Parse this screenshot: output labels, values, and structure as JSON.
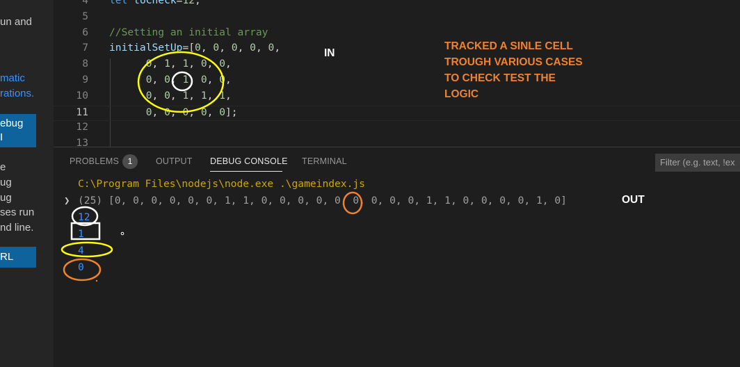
{
  "sidebar": {
    "lines": [
      "un and",
      "matic",
      "rations.",
      "e",
      "ug",
      "ug",
      "ses run",
      "nd line."
    ],
    "buttons": [
      "ebug",
      "I",
      "RL"
    ]
  },
  "editor": {
    "lines": [
      {
        "num": "4",
        "code": [
          {
            "t": "let ",
            "k": "kw"
          },
          {
            "t": "toCheck",
            "k": "var"
          },
          {
            "t": "=",
            "k": ""
          },
          {
            "t": "12",
            "k": "num"
          },
          {
            "t": ";",
            "k": ""
          }
        ]
      },
      {
        "num": "5",
        "code": []
      },
      {
        "num": "6",
        "code": [
          {
            "t": "//Setting an initial array",
            "k": "comment"
          }
        ]
      },
      {
        "num": "7",
        "code": [
          {
            "t": "initialSetUp",
            "k": "var"
          },
          {
            "t": "=[",
            "k": ""
          },
          {
            "t": "0",
            "k": "num"
          },
          {
            "t": ", ",
            "k": ""
          },
          {
            "t": "0",
            "k": "num"
          },
          {
            "t": ", ",
            "k": ""
          },
          {
            "t": "0",
            "k": "num"
          },
          {
            "t": ", ",
            "k": ""
          },
          {
            "t": "0",
            "k": "num"
          },
          {
            "t": ", ",
            "k": ""
          },
          {
            "t": "0",
            "k": "num"
          },
          {
            "t": ",",
            "k": ""
          }
        ]
      },
      {
        "num": "8",
        "code": [
          {
            "t": "      ",
            "k": ""
          },
          {
            "t": "0",
            "k": "num"
          },
          {
            "t": ", ",
            "k": ""
          },
          {
            "t": "1",
            "k": "num"
          },
          {
            "t": ", ",
            "k": ""
          },
          {
            "t": "1",
            "k": "num"
          },
          {
            "t": ", ",
            "k": ""
          },
          {
            "t": "0",
            "k": "num"
          },
          {
            "t": ", ",
            "k": ""
          },
          {
            "t": "0",
            "k": "num"
          },
          {
            "t": ",",
            "k": ""
          }
        ]
      },
      {
        "num": "9",
        "code": [
          {
            "t": "      ",
            "k": ""
          },
          {
            "t": "0",
            "k": "num"
          },
          {
            "t": ", ",
            "k": ""
          },
          {
            "t": "0",
            "k": "num"
          },
          {
            "t": ", ",
            "k": ""
          },
          {
            "t": "1",
            "k": "num"
          },
          {
            "t": ", ",
            "k": ""
          },
          {
            "t": "0",
            "k": "num"
          },
          {
            "t": ", ",
            "k": ""
          },
          {
            "t": "0",
            "k": "num"
          },
          {
            "t": ",",
            "k": ""
          }
        ]
      },
      {
        "num": "10",
        "code": [
          {
            "t": "      ",
            "k": ""
          },
          {
            "t": "0",
            "k": "num"
          },
          {
            "t": ", ",
            "k": ""
          },
          {
            "t": "0",
            "k": "num"
          },
          {
            "t": ", ",
            "k": ""
          },
          {
            "t": "1",
            "k": "num"
          },
          {
            "t": ", ",
            "k": ""
          },
          {
            "t": "1",
            "k": "num"
          },
          {
            "t": ", ",
            "k": ""
          },
          {
            "t": "1",
            "k": "num"
          },
          {
            "t": ",",
            "k": ""
          }
        ]
      },
      {
        "num": "11",
        "active": true,
        "code": [
          {
            "t": "      ",
            "k": ""
          },
          {
            "t": "0",
            "k": "num"
          },
          {
            "t": ", ",
            "k": ""
          },
          {
            "t": "0",
            "k": "num"
          },
          {
            "t": ", ",
            "k": ""
          },
          {
            "t": "0",
            "k": "num"
          },
          {
            "t": ", ",
            "k": ""
          },
          {
            "t": "0",
            "k": "num"
          },
          {
            "t": ", ",
            "k": ""
          },
          {
            "t": "0",
            "k": "num"
          },
          {
            "t": "];",
            "k": ""
          }
        ]
      },
      {
        "num": "12",
        "code": []
      },
      {
        "num": "13",
        "code": []
      }
    ]
  },
  "panel": {
    "tabs": {
      "problems": "PROBLEMS",
      "problems_count": "1",
      "output": "OUTPUT",
      "debug_console": "DEBUG CONSOLE",
      "terminal": "TERMINAL"
    },
    "filter_placeholder": "Filter (e.g. text, !ex",
    "console": {
      "command": "C:\\Program Files\\nodejs\\node.exe .\\gameindex.js",
      "array_output": "(25) [0, 0, 0, 0, 0, 0, 1, 1, 0, 0, 0, 0, 0, 0, 0, 0, 0, 1, 1, 0, 0, 0, 0, 1, 0]",
      "values": [
        "12",
        "1",
        "4",
        "0"
      ]
    }
  },
  "annotations": {
    "in_label": "IN",
    "out_label": "OUT",
    "note": "TRACKED A SINLE CELL\nTROUGH VARIOUS CASES\nTO CHECK TEST THE\nLOGIC",
    "colors": {
      "yellow": "#ffff00",
      "orange": "#f0822d",
      "white": "#ffffff"
    }
  }
}
